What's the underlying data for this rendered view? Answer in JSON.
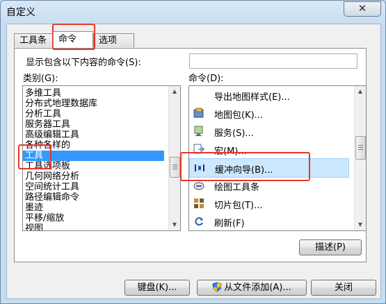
{
  "window": {
    "title": "自定义",
    "close_glyph": "✕"
  },
  "tabs": [
    {
      "label": "工具条",
      "active": false
    },
    {
      "label": "命令",
      "active": true
    },
    {
      "label": "选项",
      "active": false
    }
  ],
  "filter": {
    "label": "显示包含以下内容的命令(S):",
    "value": ""
  },
  "categories": {
    "label": "类别(G):",
    "items": [
      "多维工具",
      "分布式地理数据库",
      "分析工具",
      "服务器工具",
      "高级编辑工具",
      "各种各样的",
      "工具",
      "工具选项板",
      "几何网络分析",
      "空间统计工具",
      "路径编辑命令",
      "墨迹",
      "平移/缩放",
      "视图"
    ],
    "selected": "工具"
  },
  "commands": {
    "label": "命令(D):",
    "items": [
      {
        "label": "导出地图样式(E)...",
        "icon": "none"
      },
      {
        "label": "地图包(K)...",
        "icon": "map-package-icon"
      },
      {
        "label": "服务(S)...",
        "icon": "service-icon"
      },
      {
        "label": "宏(M)...",
        "icon": "macro-icon"
      },
      {
        "label": "缓冲向导(B)...",
        "icon": "buffer-wizard-icon",
        "selected": true
      },
      {
        "label": "绘图工具条",
        "icon": "draw-toolbar-icon"
      },
      {
        "label": "切片包(T)...",
        "icon": "tile-package-icon"
      },
      {
        "label": "刷新(F)",
        "icon": "refresh-icon"
      }
    ]
  },
  "buttons": {
    "describe": "描述(P)",
    "keyboard": "键盘(K)...",
    "add_from_file": "从文件添加(A)...",
    "close": "关闭"
  },
  "colors": {
    "selection": "#3399ff",
    "highlight": "#e8352b"
  }
}
